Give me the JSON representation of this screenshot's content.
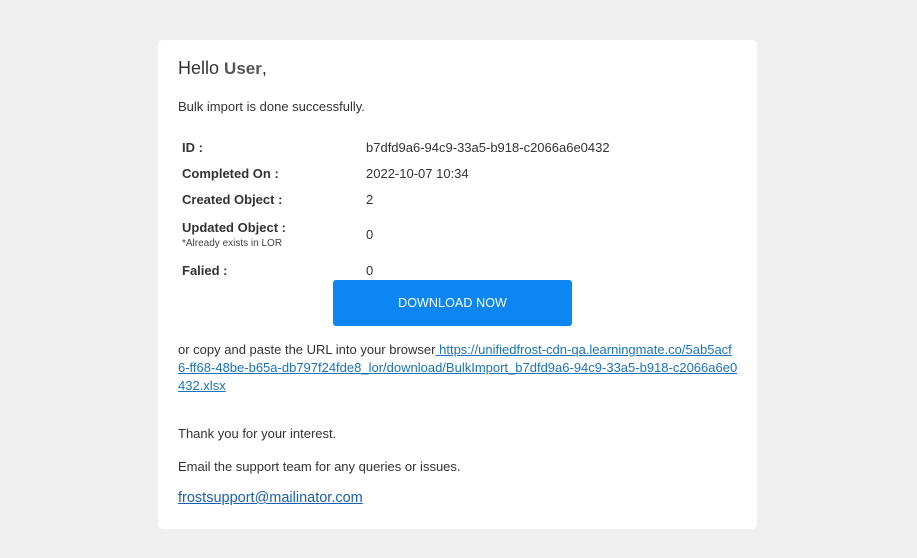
{
  "email": {
    "greeting_prefix": "Hello",
    "greeting_user": "User",
    "greeting_suffix": ",",
    "intro": "Bulk import is done successfully.",
    "details": {
      "id_label": "ID :",
      "id_value": "b7dfd9a6-94c9-33a5-b918-c2066a6e0432",
      "completed_label": "Completed On :",
      "completed_value": "2022-10-07 10:34",
      "created_label": "Created Object :",
      "created_value": "2",
      "updated_label": "Updated Object :",
      "updated_note": "*Already exists in LOR",
      "updated_value": "0",
      "failed_label": "Falied :",
      "failed_value": "0"
    },
    "download_button": "DOWNLOAD NOW",
    "url_prefix": "or copy and paste the URL into your browser",
    "url_link": " https://unifiedfrost-cdn-qa.learningmate.co/5ab5acf6-ff68-48be-b65a-db797f24fde8_lor/download/BulkImport_b7dfd9a6-94c9-33a5-b918-c2066a6e0432.xlsx",
    "thanks": "Thank you for your interest.",
    "support_line": "Email the support team for any queries or issues.",
    "support_email": "frostsupport@mailinator.com"
  },
  "colors": {
    "background": "#efefef",
    "card": "#ffffff",
    "button": "#0b86f2",
    "link": "#1a73b8"
  }
}
